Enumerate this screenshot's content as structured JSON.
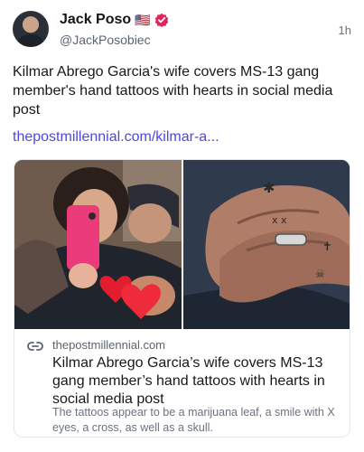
{
  "author": {
    "name": "Jack Poso",
    "flag": "🇺🇸",
    "handle": "@JackPosobiec",
    "time": "1h"
  },
  "post": {
    "text": "Kilmar Abrego Garcia's wife covers MS-13 gang member's hand tattoos with hearts in social media post",
    "link": "thepostmillennial.com/kilmar-a..."
  },
  "card": {
    "domain": "thepostmillennial.com",
    "title": "Kilmar Abrego Garcia’s wife covers MS-13 gang member’s hand tattoos with hearts in social media post",
    "description": "The tattoos appear to be a marijuana leaf, a smile with X eyes, a cross, as well as a skull."
  },
  "colors": {
    "accent_link": "#4f46e5",
    "verified": "#e0245e"
  }
}
